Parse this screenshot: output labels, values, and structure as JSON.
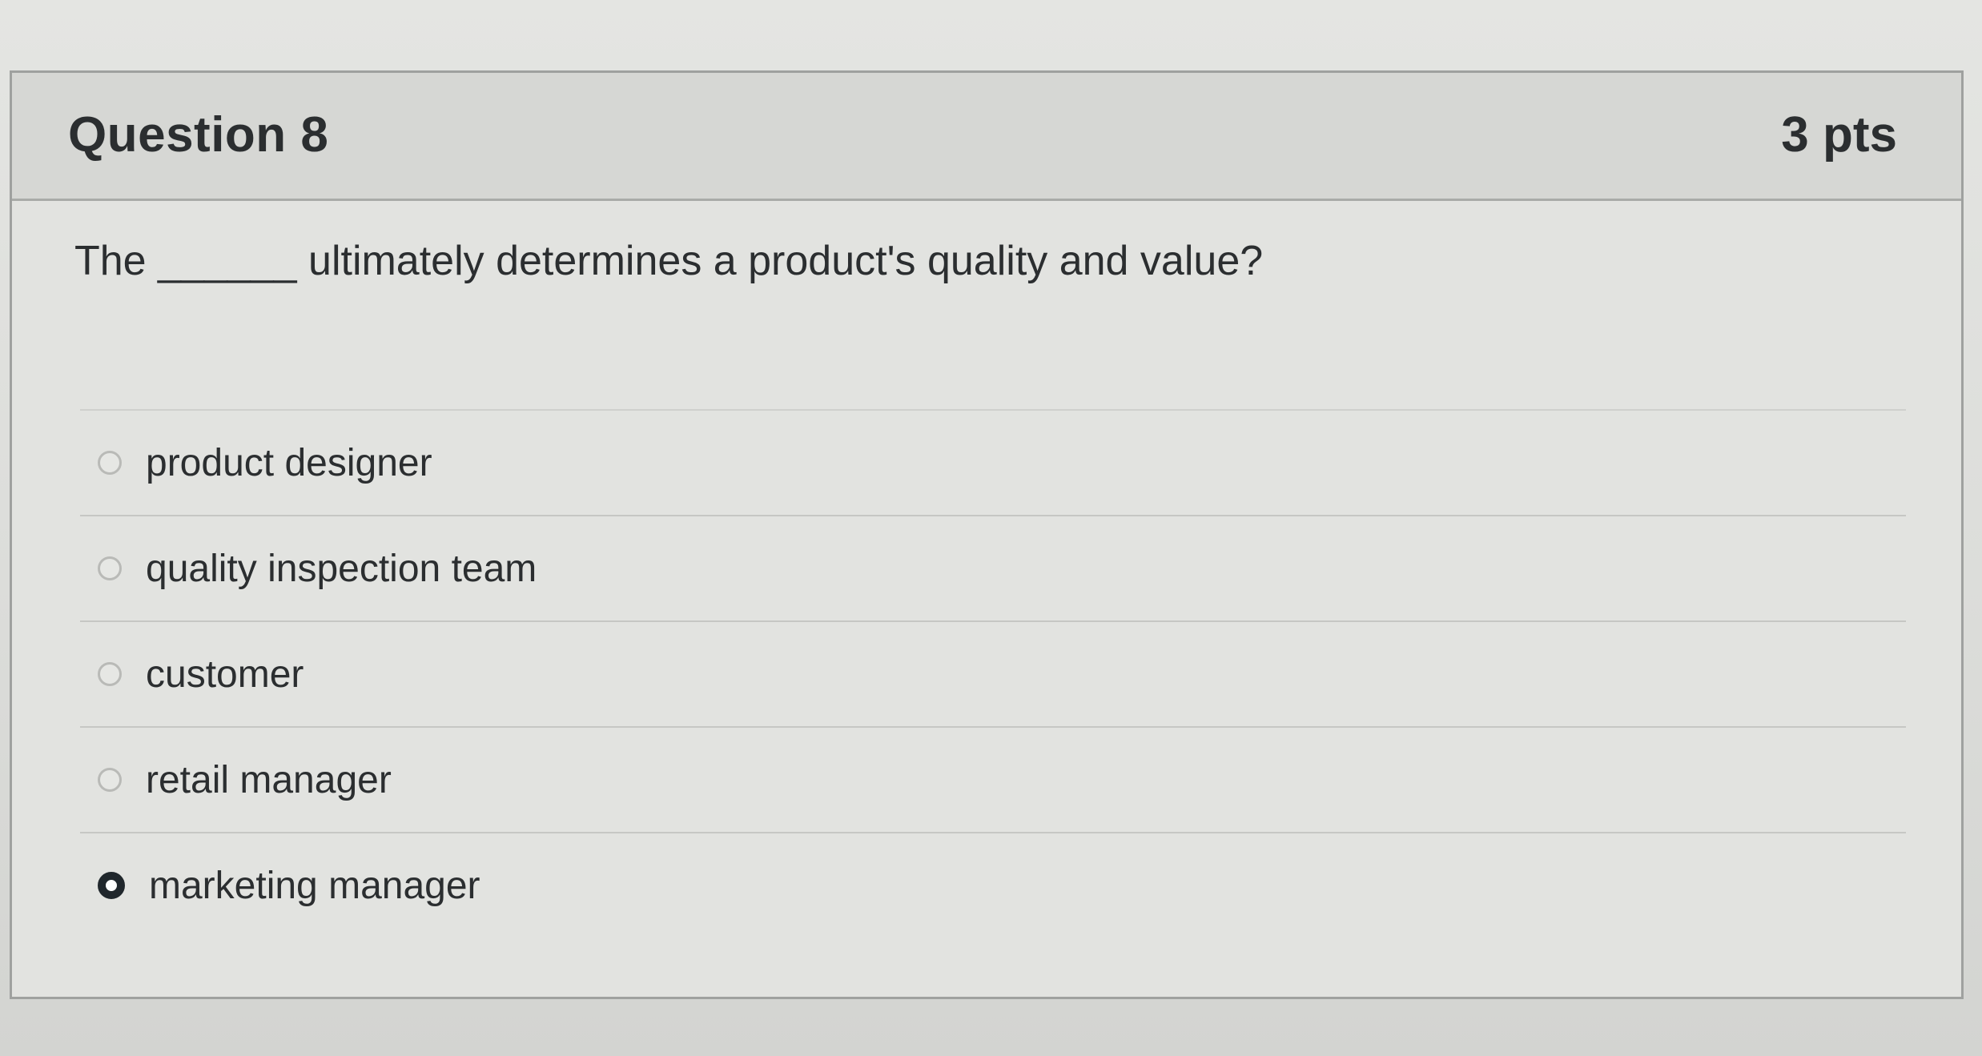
{
  "question": {
    "title": "Question 8",
    "points": "3 pts",
    "text": "The ______ ultimately determines a product's quality and value?"
  },
  "answers": [
    {
      "label": "product designer",
      "selected": false
    },
    {
      "label": "quality inspection team",
      "selected": false
    },
    {
      "label": "customer",
      "selected": false
    },
    {
      "label": "retail manager",
      "selected": false
    },
    {
      "label": "marketing manager",
      "selected": true
    }
  ],
  "colors": {
    "background": "#d9dad7",
    "header": "#d6d7d4",
    "text": "#2b2e30",
    "radio_selected": "#20272c"
  }
}
